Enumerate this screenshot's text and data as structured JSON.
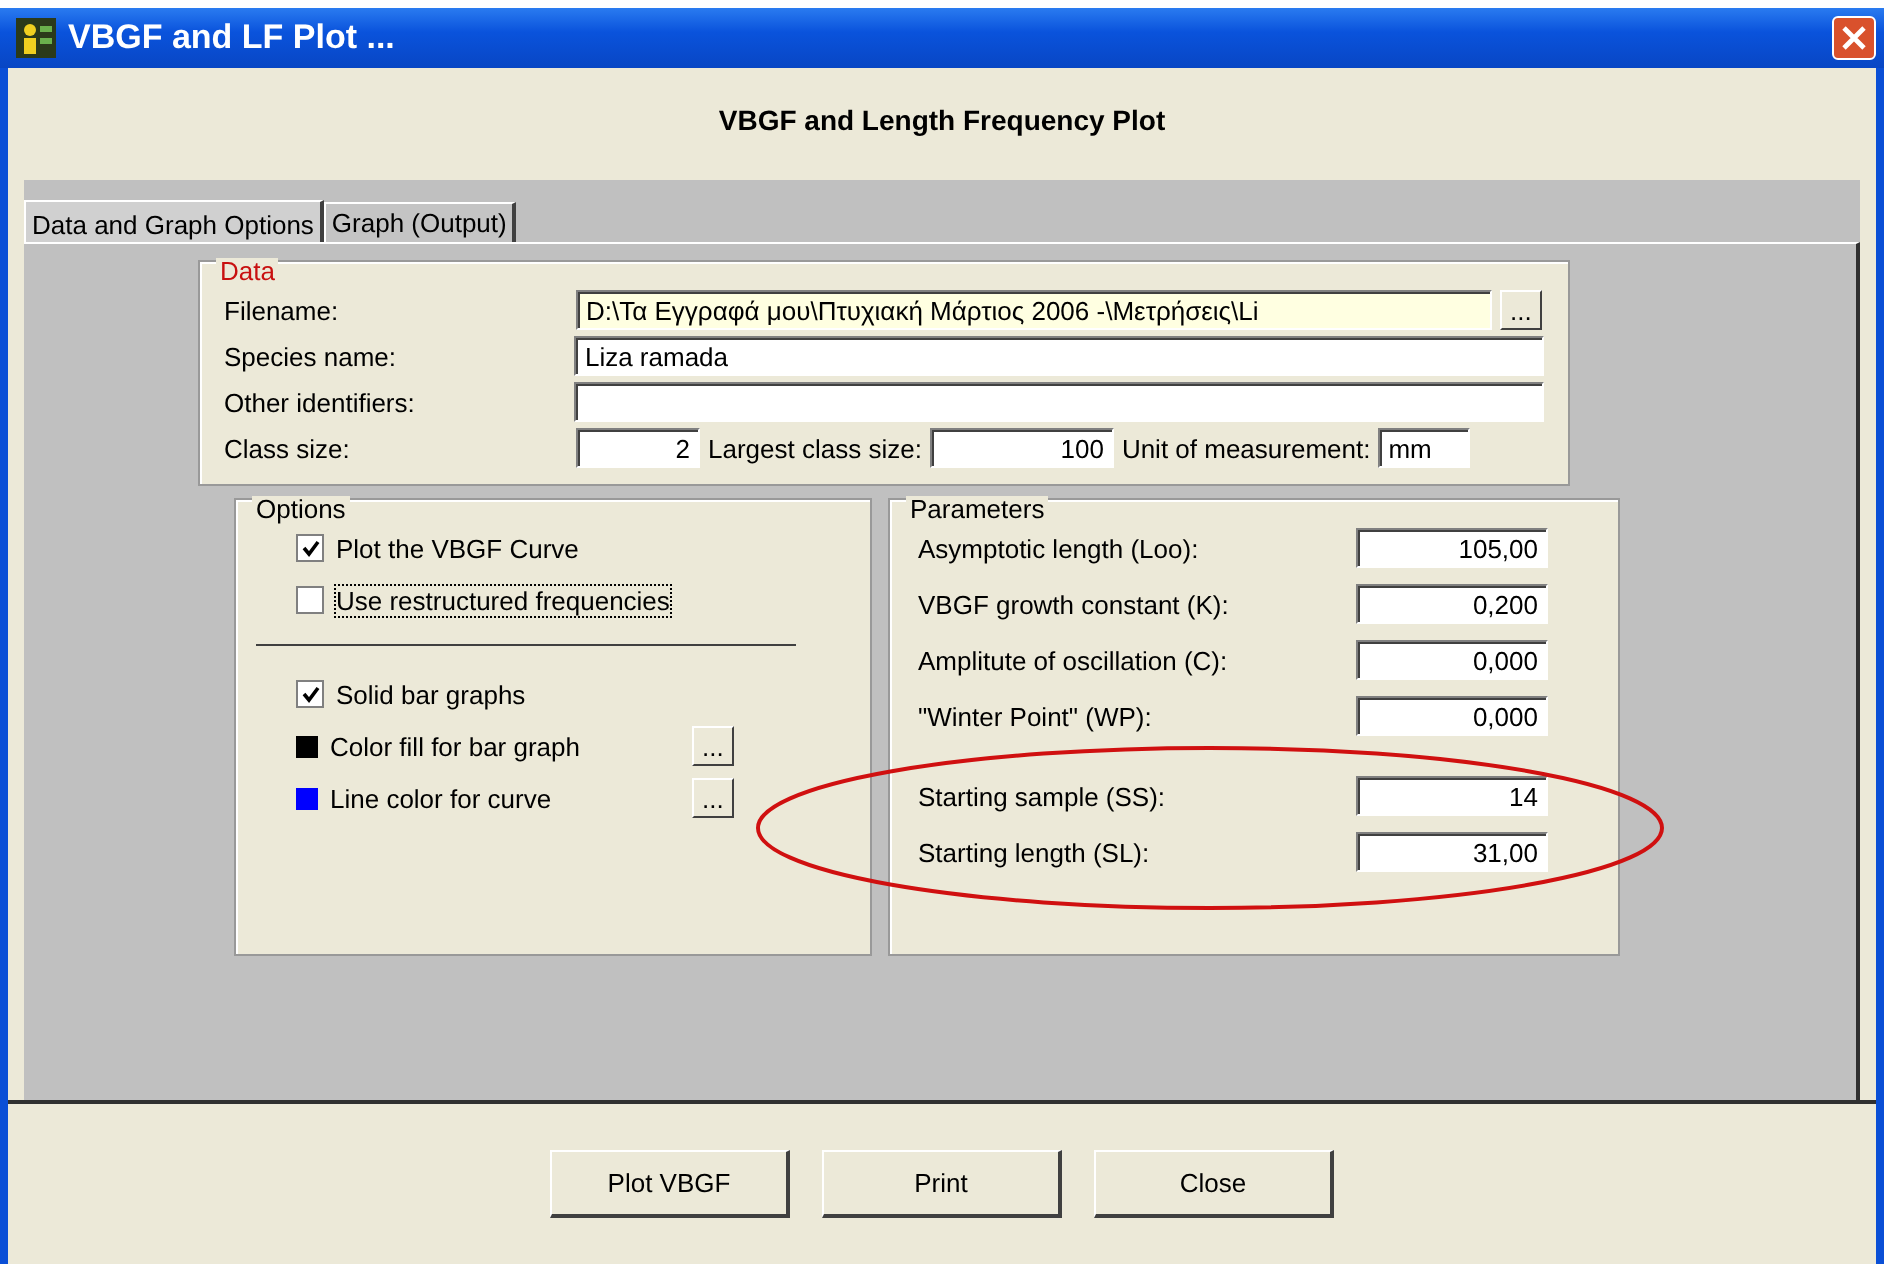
{
  "window": {
    "title": "VBGF and LF Plot ..."
  },
  "heading": "VBGF and Length Frequency Plot",
  "tabs": [
    {
      "label": "Data and Graph Options",
      "selected": true
    },
    {
      "label": "Graph (Output)",
      "selected": false
    }
  ],
  "data_group": {
    "title": "Data",
    "filename": {
      "label": "Filename:",
      "value": "D:\\Τα Εγγραφά μου\\Πτυχιακή Μάρτιος 2006 -\\Μετρήσεις\\Li",
      "browse": "..."
    },
    "species": {
      "label": "Species name:",
      "value": "Liza ramada"
    },
    "other": {
      "label": "Other identifiers:"
    },
    "class_size": {
      "label": "Class size:",
      "value": "2"
    },
    "largest_class": {
      "label": "Largest class size:",
      "value": "100"
    },
    "unit": {
      "label": "Unit of measurement:",
      "value": "mm"
    }
  },
  "options_group": {
    "title": "Options",
    "items": [
      {
        "kind": "checkbox",
        "label": "Plot the VBGF Curve",
        "checked": true,
        "focused": false
      },
      {
        "kind": "checkbox",
        "label": "Use restructured frequencies",
        "checked": false,
        "focused": true
      },
      {
        "kind": "separator"
      },
      {
        "kind": "checkbox",
        "label": "Solid bar graphs",
        "checked": true,
        "focused": false
      },
      {
        "kind": "color",
        "label": "Color fill for bar graph",
        "color": "#000000",
        "button": "..."
      },
      {
        "kind": "color",
        "label": "Line color for curve",
        "color": "#0000ff",
        "button": "..."
      }
    ]
  },
  "parameters_group": {
    "title": "Parameters",
    "rows": [
      {
        "label": "Asymptotic length (Loo):",
        "value": "105,00"
      },
      {
        "label": "VBGF growth constant (K):",
        "value": "0,200"
      },
      {
        "label": "Amplitute of oscillation (C):",
        "value": "0,000"
      },
      {
        "label": "\"Winter Point\" (WP):",
        "value": "0,000"
      },
      {
        "label": "Starting sample (SS):",
        "value": "14"
      },
      {
        "label": "Starting length (SL):",
        "value": "31,00"
      }
    ]
  },
  "buttons": [
    "Plot VBGF",
    "Print",
    "Close"
  ]
}
